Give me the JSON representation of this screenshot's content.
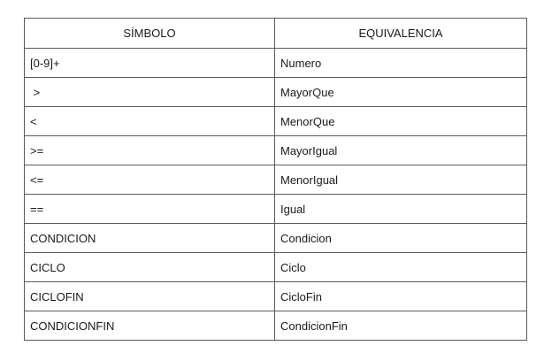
{
  "table": {
    "headers": [
      "SÍMBOLO",
      "EQUIVALENCIA"
    ],
    "rows": [
      [
        "[0-9]+",
        "Numero"
      ],
      [
        " >",
        "MayorQue"
      ],
      [
        "<",
        "MenorQue"
      ],
      [
        ">=",
        "MayorIgual"
      ],
      [
        "<=",
        "MenorIgual"
      ],
      [
        "==",
        "Igual"
      ],
      [
        "CONDICION",
        "Condicion"
      ],
      [
        "CICLO",
        "Ciclo"
      ],
      [
        "CICLOFIN",
        "CicloFin"
      ],
      [
        "CONDICIONFIN",
        "CondicionFin"
      ]
    ]
  }
}
